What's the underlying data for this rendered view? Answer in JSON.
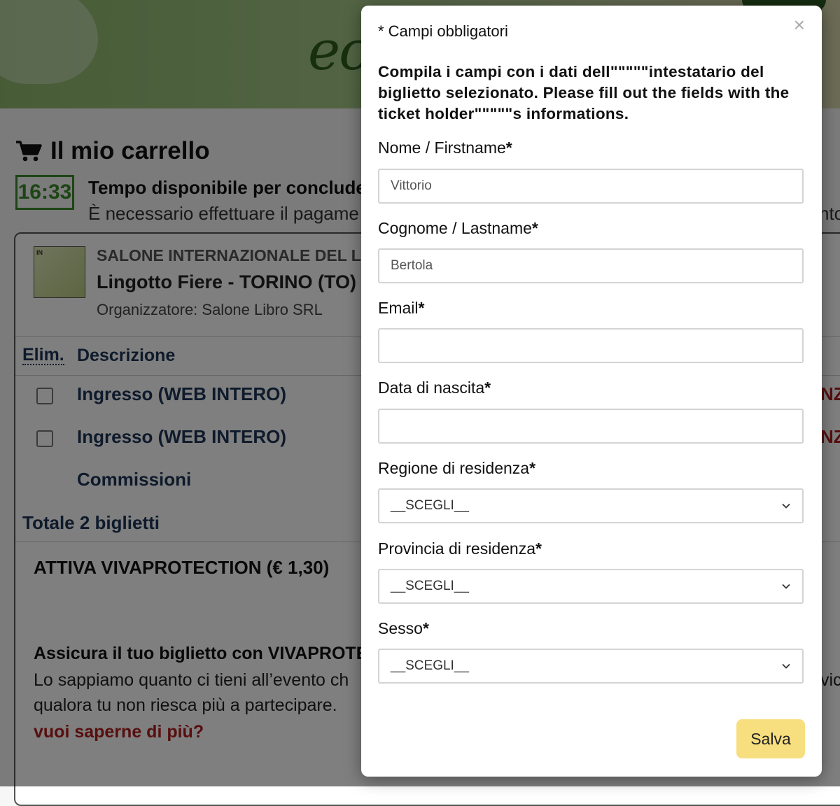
{
  "page": {
    "banner_text": "ec",
    "cart": {
      "title": "Il mio carrello",
      "timer": "16:33",
      "timer_title": "Tempo disponibile per concludere",
      "timer_sub": "È necessario effettuare il pagame",
      "right_edge_fragment": "nto"
    },
    "event": {
      "thumb_mark": "IN",
      "name": "SALONE INTERNAZIONALE DEL LIBR",
      "place": "Lingotto Fiere - TORINO (TO) - I",
      "organizer": "Organizzatore: Salone Libro SRL"
    },
    "table": {
      "col_elim": "Elim.",
      "col_desc": "Descrizione",
      "rows": [
        {
          "label": "Ingresso (WEB INTERO)",
          "price_fragment": "NZI"
        },
        {
          "label": "Ingresso (WEB INTERO)",
          "price_fragment": "NZI"
        },
        {
          "label": "Commissioni"
        }
      ],
      "total": "Totale 2 biglietti"
    },
    "protection": {
      "title": "ATTIVA VIVAPROTECTION (€ 1,30)",
      "insure_title": "Assicura il tuo biglietto con VIVAPROTE",
      "insure_line1": "Lo sappiamo quanto ci tieni all’evento ch",
      "insure_line1_right": "vic",
      "insure_line2": "qualora tu non riesca più a partecipare.",
      "link": "vuoi saperne di più?"
    }
  },
  "modal": {
    "close_glyph": "×",
    "required_note": "* Campi obbligatori",
    "intro": "Compila i campi con i dati dell\"\"\"\"\"intestatario del biglietto selezionato. Please fill out the fields with the ticket holder\"\"\"\"\"s informations.",
    "fields": {
      "firstname": {
        "label": "Nome / Firstname",
        "value": "Vittorio"
      },
      "lastname": {
        "label": "Cognome / Lastname",
        "value": "Bertola"
      },
      "email": {
        "label": "Email",
        "value": ""
      },
      "birthdate": {
        "label": "Data di nascita",
        "value": ""
      },
      "region": {
        "label": "Regione di residenza",
        "selected": "__SCEGLI__"
      },
      "province": {
        "label": "Provincia di residenza",
        "selected": "__SCEGLI__"
      },
      "gender": {
        "label": "Sesso",
        "selected": "__SCEGLI__"
      }
    },
    "required_star": "*",
    "save_label": "Salva"
  },
  "colors": {
    "timer_green": "#3a8a2a",
    "link_red": "#b01c1c",
    "heading_navy": "#1d3557",
    "save_button": "#f7df80"
  },
  "icons": [
    "cart-icon",
    "close-icon",
    "chevron-down-icon"
  ]
}
